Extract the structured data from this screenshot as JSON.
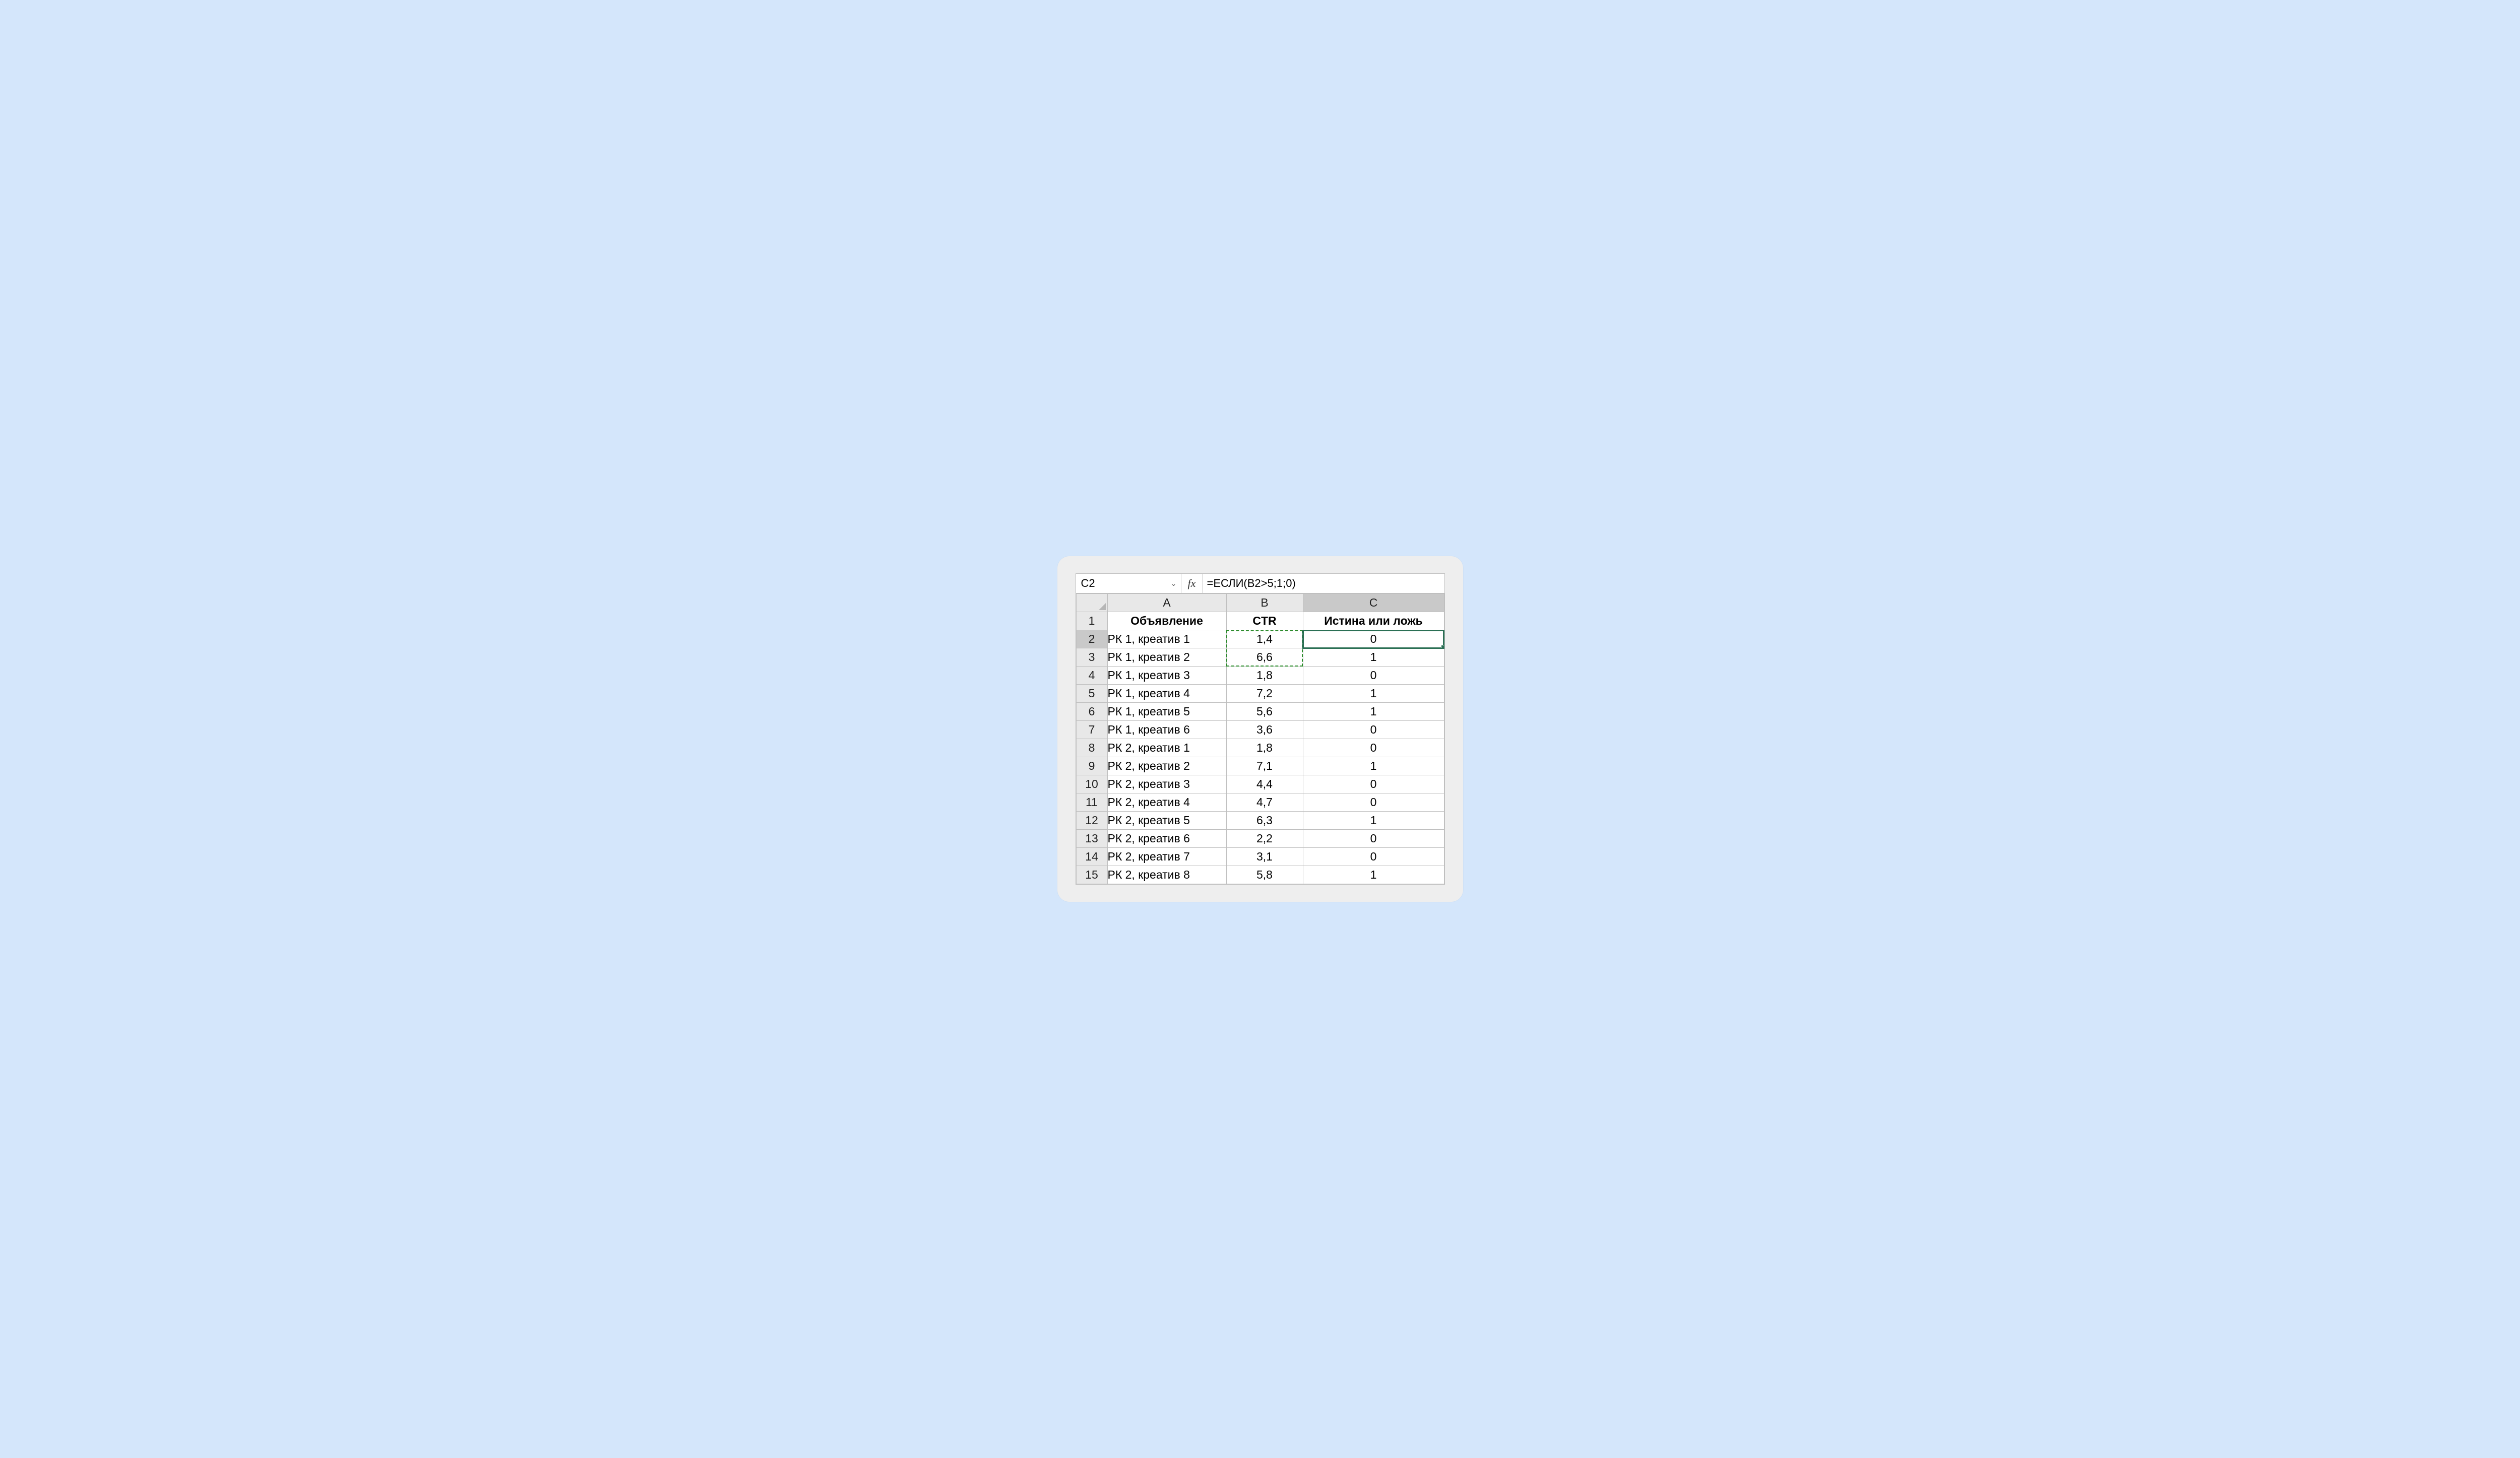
{
  "nameBox": "C2",
  "fxLabel": "fx",
  "formula": "=ЕСЛИ(B2>5;1;0)",
  "columns": [
    "A",
    "B",
    "C"
  ],
  "headerRow": {
    "num": "1",
    "a": "Объявление",
    "b": "CTR",
    "c": "Истина или ложь"
  },
  "rows": [
    {
      "num": "2",
      "a": "РК 1, креатив 1",
      "b": "1,4",
      "c": "0"
    },
    {
      "num": "3",
      "a": "РК 1, креатив 2",
      "b": "6,6",
      "c": "1"
    },
    {
      "num": "4",
      "a": "РК 1, креатив 3",
      "b": "1,8",
      "c": "0"
    },
    {
      "num": "5",
      "a": "РК 1, креатив 4",
      "b": "7,2",
      "c": "1"
    },
    {
      "num": "6",
      "a": "РК 1, креатив 5",
      "b": "5,6",
      "c": "1"
    },
    {
      "num": "7",
      "a": "РК 1, креатив 6",
      "b": "3,6",
      "c": "0"
    },
    {
      "num": "8",
      "a": "РК 2, креатив 1",
      "b": "1,8",
      "c": "0"
    },
    {
      "num": "9",
      "a": "РК 2, креатив 2",
      "b": "7,1",
      "c": "1"
    },
    {
      "num": "10",
      "a": "РК 2, креатив 3",
      "b": "4,4",
      "c": "0"
    },
    {
      "num": "11",
      "a": "РК 2, креатив 4",
      "b": "4,7",
      "c": "0"
    },
    {
      "num": "12",
      "a": "РК 2, креатив 5",
      "b": "6,3",
      "c": "1"
    },
    {
      "num": "13",
      "a": "РК 2, креатив 6",
      "b": "2,2",
      "c": "0"
    },
    {
      "num": "14",
      "a": "РК 2, креатив 7",
      "b": "3,1",
      "c": "0"
    },
    {
      "num": "15",
      "a": "РК 2, креатив 8",
      "b": "5,8",
      "c": "1"
    }
  ],
  "selection": {
    "cell": "C2"
  },
  "dashedRange": "B2:B3"
}
